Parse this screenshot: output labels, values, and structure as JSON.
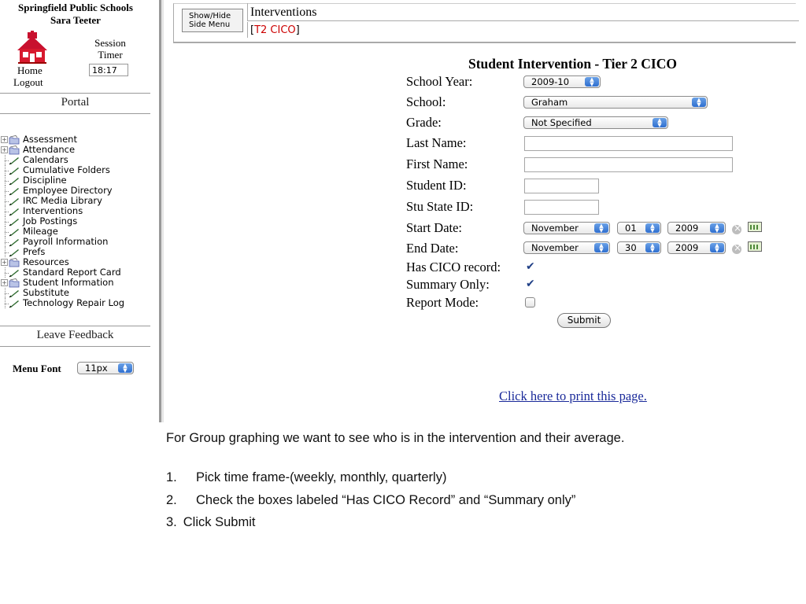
{
  "sidebar": {
    "district": "Springfield Public Schools",
    "user": "Sara Teeter",
    "home": "Home",
    "logout": "Logout",
    "session_label_1": "Session",
    "session_label_2": "Timer",
    "session_timer": "18:17",
    "portal": "Portal",
    "menu": [
      {
        "label": "Assessment",
        "type": "folder"
      },
      {
        "label": "Attendance",
        "type": "folder"
      },
      {
        "label": "Calendars",
        "type": "link"
      },
      {
        "label": "Cumulative Folders",
        "type": "link"
      },
      {
        "label": "Discipline",
        "type": "link"
      },
      {
        "label": "Employee Directory",
        "type": "link"
      },
      {
        "label": "IRC Media Library",
        "type": "link"
      },
      {
        "label": "Interventions",
        "type": "link"
      },
      {
        "label": "Job Postings",
        "type": "link"
      },
      {
        "label": "Mileage",
        "type": "link"
      },
      {
        "label": "Payroll Information",
        "type": "link"
      },
      {
        "label": "Prefs",
        "type": "link"
      },
      {
        "label": "Resources",
        "type": "folder"
      },
      {
        "label": "Standard Report Card",
        "type": "link"
      },
      {
        "label": "Student Information",
        "type": "folder"
      },
      {
        "label": "Substitute",
        "type": "link"
      },
      {
        "label": "Technology Repair Log",
        "type": "link"
      }
    ],
    "leave_feedback": "Leave Feedback",
    "menu_font_label": "Menu Font",
    "menu_font_value": "11px"
  },
  "header": {
    "show_hide_1": "Show/Hide",
    "show_hide_2": "Side Menu",
    "title": "Interventions",
    "crumb_open": "[",
    "crumb_value": "T2 CICO",
    "crumb_close": "]"
  },
  "form": {
    "title": "Student Intervention - Tier 2 CICO",
    "school_year_label": "School Year:",
    "school_year": "2009-10",
    "school_label": "School:",
    "school": "Graham",
    "grade_label": "Grade:",
    "grade": "Not Specified",
    "last_name_label": "Last Name:",
    "last_name": "",
    "first_name_label": "First Name:",
    "first_name": "",
    "student_id_label": "Student ID:",
    "student_id": "",
    "stu_state_id_label": "Stu State ID:",
    "stu_state_id": "",
    "start_date_label": "Start Date:",
    "start_month": "November",
    "start_day": "01",
    "start_year": "2009",
    "end_date_label": "End Date:",
    "end_month": "November",
    "end_day": "30",
    "end_year": "2009",
    "has_cico_label": "Has CICO record:",
    "summary_only_label": "Summary Only:",
    "report_mode_label": "Report Mode:",
    "submit": "Submit",
    "print_link": "Click here to print this page."
  },
  "instructions": {
    "intro": "For Group graphing we want to see who is in the intervention and their average.",
    "step1_num": "1.",
    "step1": "Pick time frame-(weekly, monthly, quarterly)",
    "step2_num": "2.",
    "step2": "Check the boxes labeled “Has CICO Record” and “Summary only”",
    "step3_num": "3.",
    "step3": "Click Submit"
  },
  "colors": {
    "crumb_red": "#cc0000",
    "link_blue": "#1a2a9a",
    "select_arrow_blue": "#2f6fd0"
  }
}
